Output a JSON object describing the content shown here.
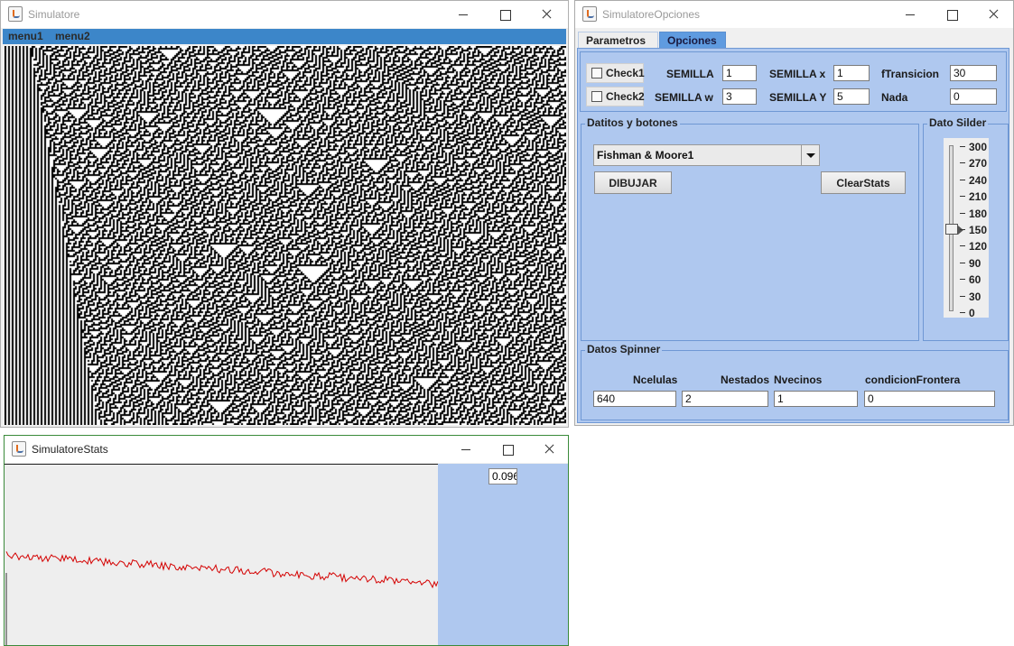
{
  "simulator_window": {
    "title": "Simulatore",
    "menus": [
      "menu1",
      "menu2"
    ]
  },
  "options_window": {
    "title": "SimulatoreOpciones",
    "tabs": [
      "Parametros",
      "Opciones"
    ],
    "active_tab": "Parametros",
    "checkboxes": [
      {
        "label": "Check1",
        "checked": false
      },
      {
        "label": "Check2",
        "checked": false
      }
    ],
    "params": {
      "semilla": {
        "label": "SEMILLA",
        "value": "1"
      },
      "semilla_x": {
        "label": "SEMILLA x",
        "value": "1"
      },
      "ftransicion": {
        "label": "fTransicion",
        "value": "30"
      },
      "semilla_w": {
        "label": "SEMILLA w",
        "value": "3"
      },
      "semilla_y": {
        "label": "SEMILLA Y",
        "value": "5"
      },
      "nada": {
        "label": "Nada",
        "value": "0"
      }
    },
    "datitos_group": {
      "title": "Datitos y botones",
      "combo_value": "Fishman & Moore1",
      "dibujar_label": "DIBUJAR",
      "clearstats_label": "ClearStats"
    },
    "slider_group": {
      "title": "Dato Silder",
      "ticks": [
        "300",
        "270",
        "240",
        "210",
        "180",
        "150",
        "120",
        "90",
        "60",
        "30",
        "0"
      ],
      "value": 150,
      "min": 0,
      "max": 300
    },
    "spinner_group": {
      "title": "Datos Spinner",
      "fields": [
        {
          "label": "Ncelulas",
          "value": "640"
        },
        {
          "label": "Nestados",
          "value": "2"
        },
        {
          "label": "Nvecinos",
          "value": "1"
        },
        {
          "label": "condicionFrontera",
          "value": "0"
        }
      ]
    }
  },
  "stats_window": {
    "title": "SimulatoreStats",
    "readout": "0.096",
    "line_color": "#d40000"
  },
  "colors": {
    "menubar": "#3c86c9",
    "panel_blue": "#afc8ef",
    "tab_inactive": "#5f9be0"
  }
}
